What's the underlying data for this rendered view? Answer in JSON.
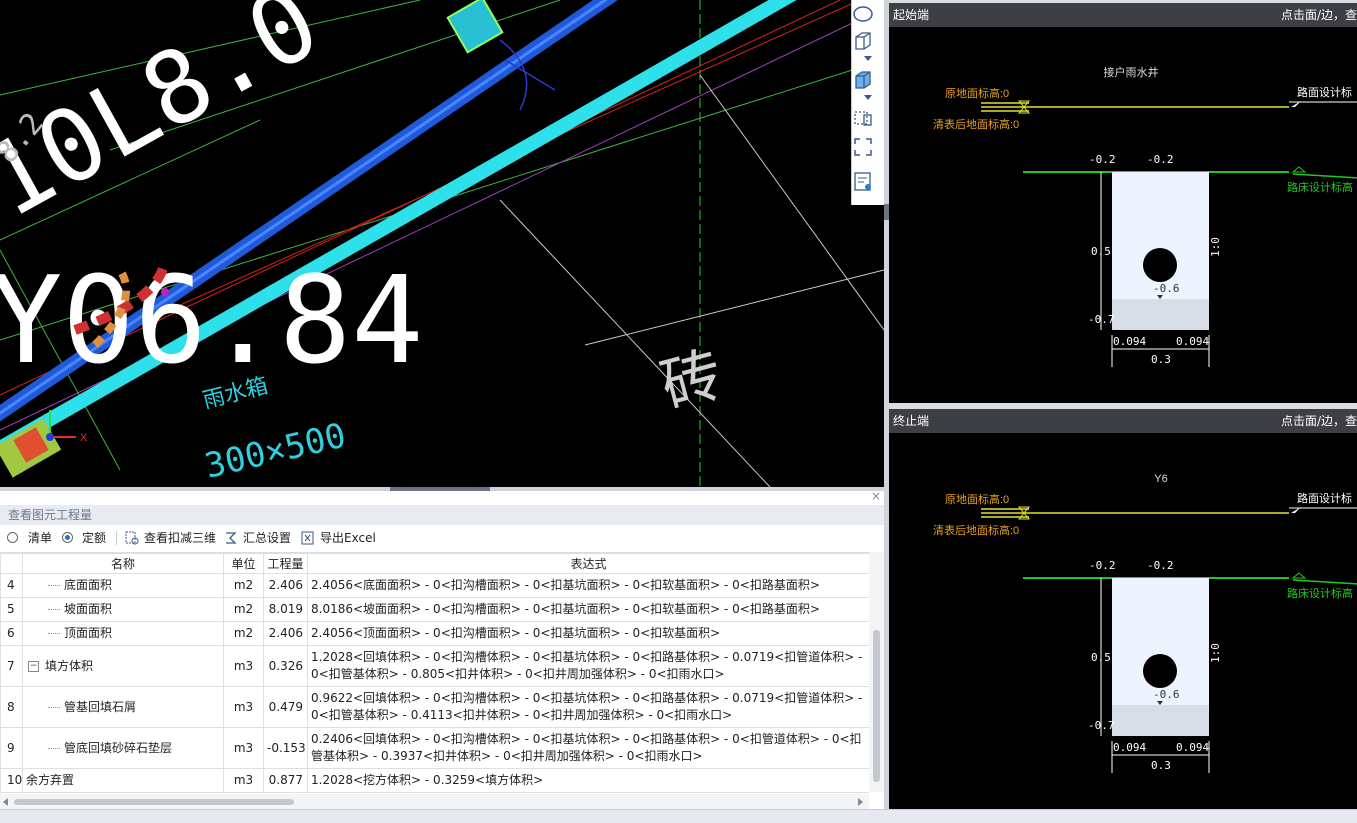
{
  "cad": {
    "texts": [
      "10L8.0",
      "Y06.84",
      "雨水箱",
      "300×500",
      "砖",
      "8.2",
      "X"
    ]
  },
  "section_start": {
    "title": "起始端",
    "hint": "点击面/边，查",
    "well_name": "接户雨水井",
    "orig_ground": "原地面标高:0",
    "clear_ground": "清表后地面标高:0",
    "road_design": "路面设计标",
    "subgrade_design": "路床设计标高",
    "top_left": "-0.2",
    "top_right": "-0.2",
    "left_mid": "0.5",
    "right_slope": "1:0",
    "pipe_elev": "-0.6",
    "bottom_left": "-0.7",
    "dim_left": "0.094",
    "dim_right": "0.094",
    "dim_total": "0.3"
  },
  "section_end": {
    "title": "终止端",
    "hint": "点击面/边，查",
    "well_name": "Y6",
    "orig_ground": "原地面标高:0",
    "clear_ground": "清表后地面标高:0",
    "road_design": "路面设计标",
    "subgrade_design": "路床设计标高",
    "top_left": "-0.2",
    "top_right": "-0.2",
    "left_mid": "0.5",
    "right_slope": "1:0",
    "pipe_elev": "-0.6",
    "bottom_left": "-0.7",
    "dim_left": "0.094",
    "dim_right": "0.094",
    "dim_total": "0.3"
  },
  "panel": {
    "title": "查看图元工程量",
    "close": "×",
    "radio_list": "清单",
    "radio_quota": "定额",
    "btn_view3d": "查看扣减三维",
    "btn_summary": "汇总设置",
    "btn_export": "导出Excel"
  },
  "table": {
    "headers": {
      "name": "名称",
      "unit": "单位",
      "qty": "工程量",
      "expr": "表达式"
    },
    "rows": [
      {
        "idx": "4",
        "name": "底面面积",
        "unit": "m2",
        "qty": "2.406",
        "expr": "2.4056<底面面积> - 0<扣沟槽面积> - 0<扣基坑面积> - 0<扣软基面积> - 0<扣路基面积>"
      },
      {
        "idx": "5",
        "name": "坡面面积",
        "unit": "m2",
        "qty": "8.019",
        "expr": "8.0186<坡面面积> - 0<扣沟槽面积> - 0<扣基坑面积> - 0<扣软基面积> - 0<扣路基面积>"
      },
      {
        "idx": "6",
        "name": "顶面面积",
        "unit": "m2",
        "qty": "2.406",
        "expr": "2.4056<顶面面积> - 0<扣沟槽面积> - 0<扣基坑面积> - 0<扣软基面积>"
      },
      {
        "idx": "7",
        "name": "填方体积",
        "unit": "m3",
        "qty": "0.326",
        "expr": "1.2028<回填体积> - 0<扣沟槽体积> - 0<扣基坑体积> - 0<扣路基体积> - 0.0719<扣管道体积> - 0<扣管基体积> - 0.805<扣井体积> - 0<扣井周加强体积> - 0<扣雨水口>"
      },
      {
        "idx": "8",
        "name": "管基回填石屑",
        "unit": "m3",
        "qty": "0.479",
        "expr": "0.9622<回填体积> - 0<扣沟槽体积> - 0<扣基坑体积> - 0<扣路基体积> - 0.0719<扣管道体积> - 0<扣管基体积> - 0.4113<扣井体积> - 0<扣井周加强体积> - 0<扣雨水口>"
      },
      {
        "idx": "9",
        "name": "管底回填砂碎石垫层",
        "unit": "m3",
        "qty": "-0.153",
        "expr": "0.2406<回填体积> - 0<扣沟槽体积> - 0<扣基坑体积> - 0<扣路基体积> - 0<扣管道体积> - 0<扣管基体积> - 0.3937<扣井体积> - 0<扣井周加强体积> - 0<扣雨水口>"
      },
      {
        "idx": "10",
        "name": "余方弃置",
        "unit": "m3",
        "qty": "0.877",
        "expr": "1.2028<挖方体积> - 0.3259<填方体积>"
      }
    ],
    "expander_minus": "−"
  },
  "colors": {
    "cad_bg": "#000000",
    "pipe_cyan": "#2de0ea",
    "pipe_blue": "#1f5ad8",
    "ground_yellow": "#e0e030",
    "subgrade_green": "#22c822",
    "well_fill": "#eef4ff",
    "label_orange": "#e8a020",
    "panel_header": "#3d3f45",
    "radio_accent": "#1e6fd9"
  },
  "icons": [
    "ellipse-select-icon",
    "box-3d-icon",
    "box-3d-filled-icon",
    "rect-select-icon",
    "fit-view-icon",
    "list-view-icon",
    "view-3d-icon",
    "summary-settings-icon",
    "excel-export-icon"
  ]
}
